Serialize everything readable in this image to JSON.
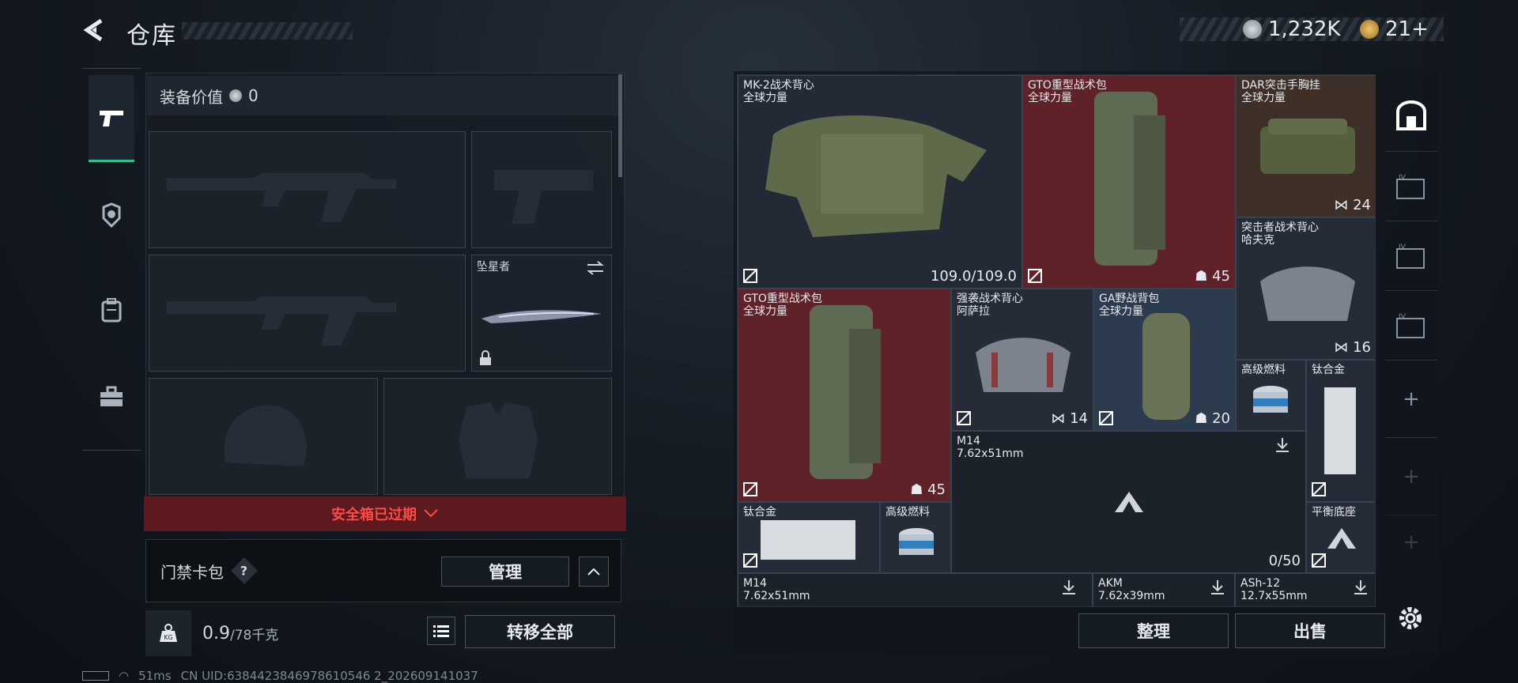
{
  "header": {
    "title": "仓库",
    "currency_silver": "1,232K",
    "currency_gold": "21+"
  },
  "left_tabs": [
    {
      "icon": "pistol-icon"
    },
    {
      "icon": "helmet-icon"
    },
    {
      "icon": "backpack-icon"
    },
    {
      "icon": "toolbox-icon"
    }
  ],
  "equipment": {
    "value_label": "装备价值",
    "value": "0",
    "melee_name": "坠星者"
  },
  "safe_box": {
    "expired_label": "安全箱已过期"
  },
  "keycard": {
    "label": "门禁卡包",
    "help": "?",
    "manage_label": "管理"
  },
  "weight": {
    "current": "0.9",
    "capacity": "/78千克"
  },
  "actions": {
    "transfer_all": "转移全部",
    "sort": "整理",
    "sell": "出售"
  },
  "status": {
    "ping": "51ms",
    "uid": "CN UID:6384423846978610546 2_202609141037"
  },
  "colors": {
    "accent_green": "#2fc08a",
    "red_cell": "#7a2b30",
    "blue_cell": "#2c3b4d",
    "brown_cell": "#4a3a30",
    "expired_red": "#ff4a48"
  },
  "items": [
    {
      "id": "mk2",
      "name": "MK-2战术背心",
      "sub": "全球力量",
      "count": "109.0/109.0"
    },
    {
      "id": "gto1",
      "name": "GTO重型战术包",
      "sub": "全球力量",
      "count": "45"
    },
    {
      "id": "dar",
      "name": "DAR突击手胸挂",
      "sub": "全球力量",
      "count": "24"
    },
    {
      "id": "assault",
      "name": "突击者战术背心",
      "sub": "哈夫克",
      "count": "16"
    },
    {
      "id": "gto2",
      "name": "GTO重型战术包",
      "sub": "全球力量",
      "count": "45"
    },
    {
      "id": "raid",
      "name": "强袭战术背心",
      "sub": "阿萨拉",
      "count": "14"
    },
    {
      "id": "ga",
      "name": "GA野战背包",
      "sub": "全球力量",
      "count": "20"
    },
    {
      "id": "fuel1",
      "name": "高级燃料",
      "sub": "",
      "count": ""
    },
    {
      "id": "ti1",
      "name": "钛合金",
      "sub": "",
      "count": ""
    },
    {
      "id": "m14a",
      "name": "M14",
      "sub": "7.62x51mm",
      "count": "0/50"
    },
    {
      "id": "ti2",
      "name": "钛合金",
      "sub": "",
      "count": ""
    },
    {
      "id": "fuel2",
      "name": "高级燃料",
      "sub": "",
      "count": ""
    },
    {
      "id": "base",
      "name": "平衡底座",
      "sub": "",
      "count": ""
    },
    {
      "id": "m14b",
      "name": "M14",
      "sub": "7.62x51mm",
      "count": ""
    },
    {
      "id": "akm",
      "name": "AKM",
      "sub": "7.62x39mm",
      "count": ""
    },
    {
      "id": "ash",
      "name": "ASh-12",
      "sub": "12.7x55mm",
      "count": ""
    }
  ],
  "right_tabs": [
    "safe-icon",
    "box-iv-icon",
    "box-iv-icon",
    "box-iv-icon",
    "plus-icon",
    "plus-icon",
    "plus-icon"
  ]
}
